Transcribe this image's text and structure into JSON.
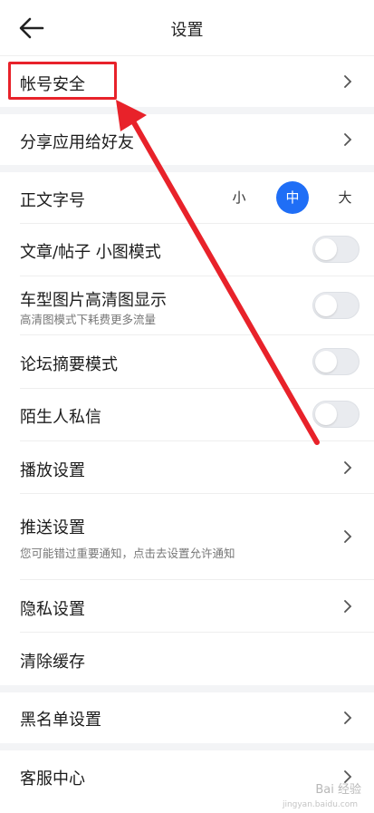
{
  "header": {
    "title": "设置"
  },
  "rows": {
    "account_security": "帐号安全",
    "share_app": "分享应用给好友",
    "font_size": {
      "label": "正文字号",
      "options": [
        "小",
        "中",
        "大"
      ],
      "selected": "中"
    },
    "article_thumb_mode": {
      "label": "文章/帖子 小图模式",
      "on": false
    },
    "hd_images": {
      "label": "车型图片高清图显示",
      "sub": "高清图模式下耗费更多流量",
      "on": false
    },
    "forum_digest": {
      "label": "论坛摘要模式",
      "on": false
    },
    "stranger_dm": {
      "label": "陌生人私信",
      "on": false
    },
    "playback": "播放设置",
    "push": {
      "label": "推送设置",
      "sub": "您可能错过重要通知，点击去设置允许通知"
    },
    "privacy": "隐私设置",
    "clear_cache": "清除缓存",
    "blacklist": "黑名单设置",
    "customer_service": "客服中心"
  },
  "annotation": {
    "color": "#e8222a"
  },
  "watermark": {
    "text": "Bai 经验",
    "sub": "jingyan.baidu.com"
  },
  "colors": {
    "accent": "#1f6ef6"
  }
}
